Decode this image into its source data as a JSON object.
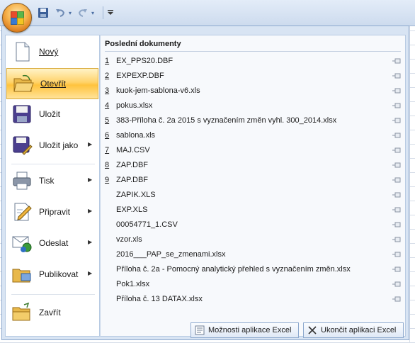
{
  "quick_access": {
    "save_icon": "save-icon",
    "undo_icon": "undo-icon",
    "redo_icon": "redo-icon",
    "customize_icon": "chevron-down-icon"
  },
  "menu": {
    "items": [
      {
        "label": "Nový",
        "icon": "new-document-icon",
        "arrow": false
      },
      {
        "label": "Otevřít",
        "icon": "open-folder-icon",
        "arrow": false,
        "active": true
      },
      {
        "label": "Uložit",
        "icon": "save-disk-icon",
        "arrow": false
      },
      {
        "label": "Uložit jako",
        "icon": "save-as-icon",
        "arrow": true
      },
      {
        "label": "Tisk",
        "icon": "printer-icon",
        "arrow": true
      },
      {
        "label": "Připravit",
        "icon": "prepare-icon",
        "arrow": true
      },
      {
        "label": "Odeslat",
        "icon": "send-icon",
        "arrow": true
      },
      {
        "label": "Publikovat",
        "icon": "publish-icon",
        "arrow": true
      },
      {
        "label": "Zavřít",
        "icon": "close-folder-icon",
        "arrow": false
      }
    ]
  },
  "recent": {
    "title": "Poslední dokumenty",
    "documents": [
      {
        "num": "1",
        "name": "EX_PPS20.DBF"
      },
      {
        "num": "2",
        "name": "EXPEXP.DBF"
      },
      {
        "num": "3",
        "name": "kuok-jem-sablona-v6.xls"
      },
      {
        "num": "4",
        "name": "pokus.xlsx"
      },
      {
        "num": "5",
        "name": "383-Příloha č. 2a 2015 s vyznačením změn vyhl. 300_2014.xlsx"
      },
      {
        "num": "6",
        "name": "sablona.xls"
      },
      {
        "num": "7",
        "name": "MAJ.CSV"
      },
      {
        "num": "8",
        "name": "ZAP.DBF"
      },
      {
        "num": "9",
        "name": "ZAP.DBF"
      },
      {
        "num": "",
        "name": "ZAPIK.XLS"
      },
      {
        "num": "",
        "name": "EXP.XLS"
      },
      {
        "num": "",
        "name": "00054771_1.CSV"
      },
      {
        "num": "",
        "name": "vzor.xls"
      },
      {
        "num": "",
        "name": "2016___PAP_se_zmenami.xlsx"
      },
      {
        "num": "",
        "name": "Příloha č. 2a - Pomocný analytický přehled s vyznačením změn.xlsx"
      },
      {
        "num": "",
        "name": "Pok1.xlsx"
      },
      {
        "num": "",
        "name": "Příloha č. 13 DATAX.xlsx"
      }
    ]
  },
  "footer": {
    "options_label": "Možnosti aplikace Excel",
    "exit_label": "Ukončit aplikaci Excel"
  },
  "colors": {
    "menu_bg": "#d8e4f3",
    "active_item": "#ffc33d",
    "frame_border": "#8da9ce"
  }
}
